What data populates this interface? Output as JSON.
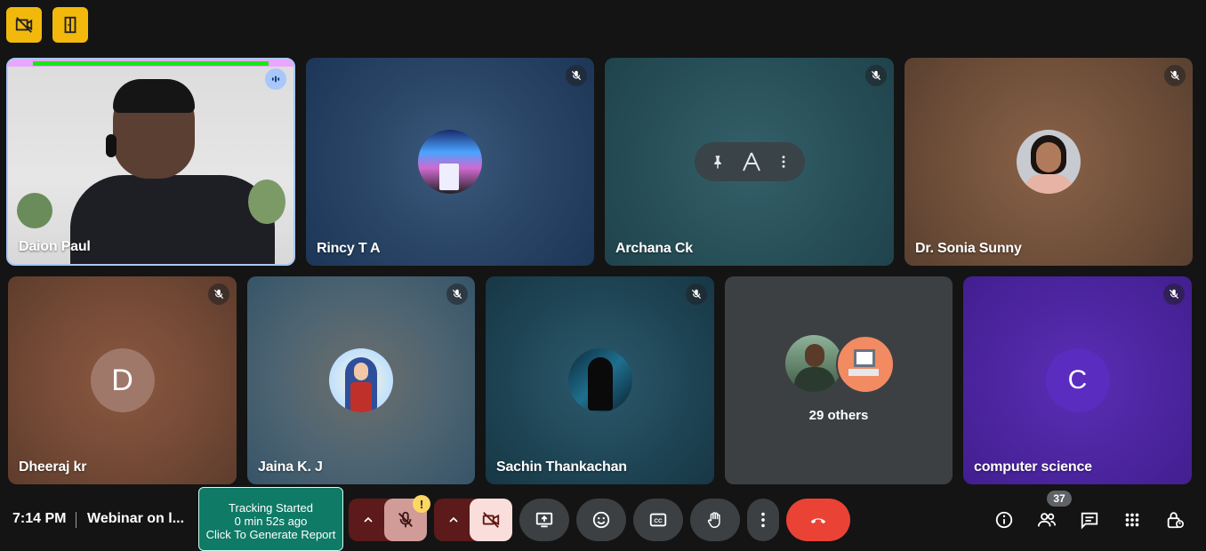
{
  "participants": {
    "tile1": {
      "name": "Daion Paul"
    },
    "tile2": {
      "name": "Rincy T A"
    },
    "tile3": {
      "name": "Archana Ck"
    },
    "tile4": {
      "name": "Dr. Sonia Sunny"
    },
    "tile5": {
      "name": "Dheeraj kr",
      "initial": "D"
    },
    "tile6": {
      "name": "Jaina K. J"
    },
    "tile7": {
      "name": "Sachin Thankachan"
    },
    "tile8": {
      "others_label": "29 others"
    },
    "tile9": {
      "name": "computer science",
      "initial": "C"
    }
  },
  "bottom_bar": {
    "time": "7:14 PM",
    "meeting_title": "Webinar on l...",
    "tracker": {
      "line1": "Tracking Started",
      "line2": "0 min 52s ago",
      "line3": "Click To Generate Report"
    },
    "participant_count": "37"
  },
  "colors": {
    "end_call": "#ea4335",
    "mic_off_bg": "#f28b82",
    "tracker_bg": "#0f7a66",
    "top_button": "#f2b90c"
  }
}
